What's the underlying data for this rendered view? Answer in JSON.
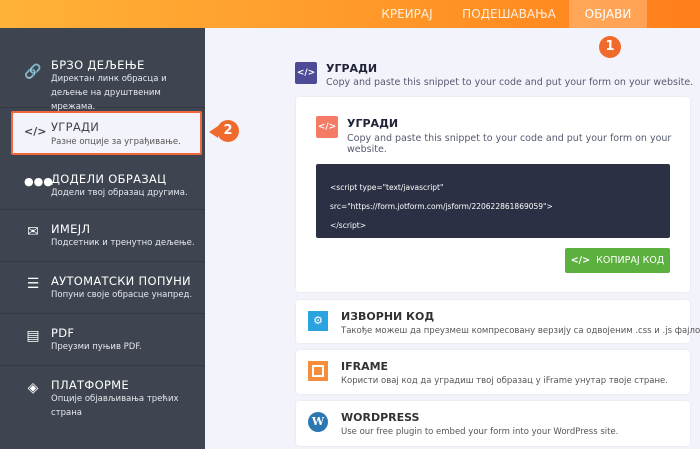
{
  "nav": {
    "tabs": [
      {
        "label": "КРЕИРАЈ"
      },
      {
        "label": "ПОДЕШАВАЊА"
      },
      {
        "label": "ОБЈАВИ",
        "active": true
      }
    ]
  },
  "badges": {
    "one": "1",
    "two": "2"
  },
  "sidebar": {
    "items": [
      {
        "title": "БРЗО ДЕЉЕЊЕ",
        "desc": "Директан линк обрасца и дељење на друштвеним мрежама.",
        "icon": "link-icon"
      },
      {
        "title": "УГРАДИ",
        "desc": "Разне опције за уграђивање.",
        "icon": "code-icon",
        "selected": true
      },
      {
        "title": "ДОДЕЛИ ОБРАЗАЦ",
        "desc": "Додели твој образац другима.",
        "icon": "users-icon"
      },
      {
        "title": "ИМЕЈЛ",
        "desc": "Подсетник и тренутно дељење.",
        "icon": "envelope-icon"
      },
      {
        "title": "АУТОМАТСКИ ПОПУНИ",
        "desc": "Попуни своје обрасце унапред.",
        "icon": "autofill-icon"
      },
      {
        "title": "PDF",
        "desc": "Преузми пуњив PDF.",
        "icon": "pdf-icon"
      },
      {
        "title": "ПЛАТФОРМЕ",
        "desc": "Опције објављивања трећих страна",
        "icon": "layers-icon"
      }
    ]
  },
  "section": {
    "title": "УГРАДИ",
    "desc": "Copy and paste this snippet to your code and put your form on your website."
  },
  "embed_card": {
    "title": "УГРАДИ",
    "desc": "Copy and paste this snippet to your code and put your form on your website.",
    "code": [
      "<script type=\"text/javascript\"",
      "src=\"https://form.jotform.com/jsform/220622861869059\">",
      "</script>"
    ],
    "copy_label": "КОПИРАЈ КОД"
  },
  "options": [
    {
      "title": "ИЗВОРНИ КОД",
      "desc": "Такође можеш да преузмеш компресовану верзију са одвојеним .css и .js фајловима",
      "icon": "gear-icon"
    },
    {
      "title": "IFRAME",
      "desc": "Користи овај код да уградиш твој образац у iFrame унутар твоје стране.",
      "icon": "iframe-icon"
    },
    {
      "title": "WORDPRESS",
      "desc": "Use our free plugin to embed your form into your WordPress site.",
      "icon": "wordpress-icon"
    }
  ],
  "colors": {
    "accent": "#ff9a2a",
    "sidebar": "#3e4550",
    "copy": "#5cb040",
    "badge": "#f06a2c"
  }
}
